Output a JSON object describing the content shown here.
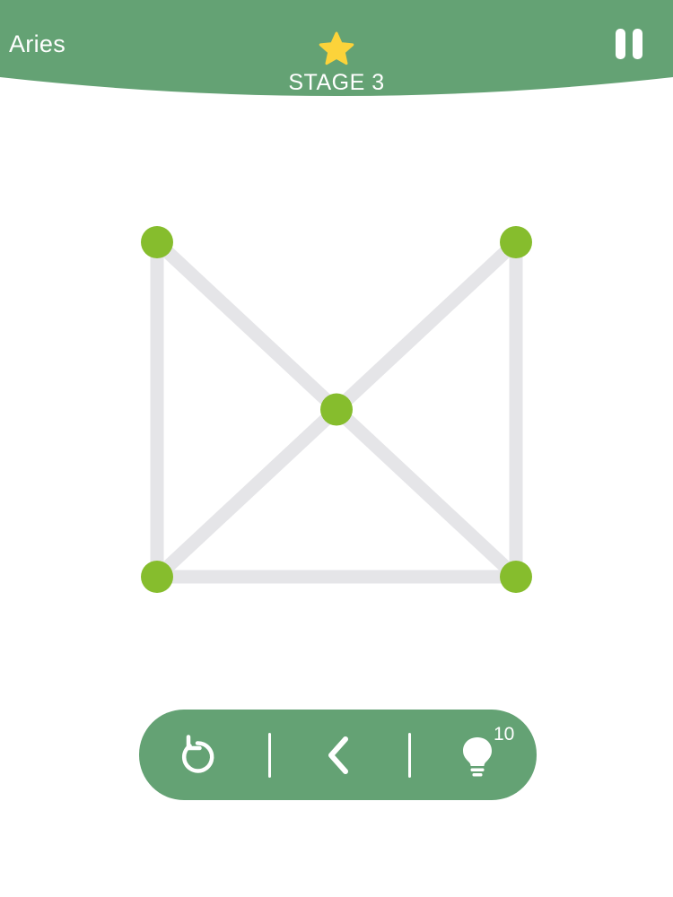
{
  "header": {
    "level_name": "Aries",
    "stage_label": "STAGE 3",
    "background_color": "#64a274",
    "star_icon": "star-icon",
    "star_color": "#fcd33a",
    "pause_icon": "pause-icon"
  },
  "puzzle": {
    "edge_color": "#e5e5e8",
    "node_color": "#86bd2d",
    "nodes": [
      {
        "id": "top-left",
        "col": 0,
        "row": 0
      },
      {
        "id": "top-right",
        "col": 2,
        "row": 0
      },
      {
        "id": "center",
        "col": 1,
        "row": 1
      },
      {
        "id": "bottom-left",
        "col": 0,
        "row": 2
      },
      {
        "id": "bottom-right",
        "col": 2,
        "row": 2
      }
    ],
    "edges": [
      [
        "top-left",
        "bottom-left"
      ],
      [
        "top-right",
        "bottom-right"
      ],
      [
        "bottom-left",
        "bottom-right"
      ],
      [
        "top-left",
        "center"
      ],
      [
        "center",
        "bottom-right"
      ],
      [
        "top-right",
        "center"
      ],
      [
        "center",
        "bottom-left"
      ]
    ]
  },
  "toolbar": {
    "background_color": "#64a274",
    "restart_icon": "restart-icon",
    "back_icon": "chevron-left-icon",
    "hint_icon": "lightbulb-icon",
    "hint_count": "10"
  }
}
